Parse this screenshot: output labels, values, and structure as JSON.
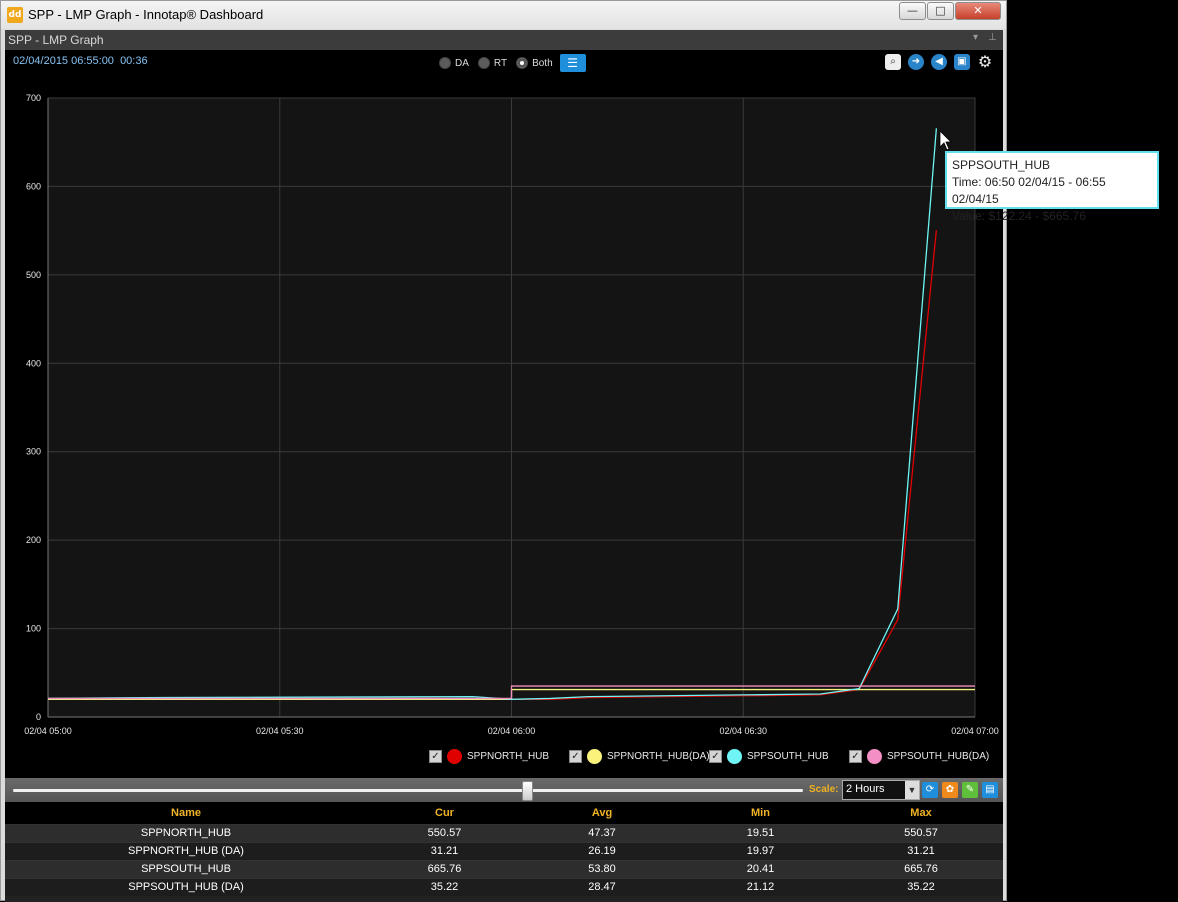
{
  "window": {
    "title": "SPP - LMP Graph - Innotap® Dashboard",
    "app_icon_text": "dd",
    "min": "—",
    "max": "□",
    "close": "✕"
  },
  "panel": {
    "title": "SPP - LMP Graph",
    "timestamp": "02/04/2015 06:55:00",
    "elapsed": "00:36",
    "modes": [
      "DA",
      "RT",
      "Both"
    ],
    "selected_mode": "Both"
  },
  "tooltip": {
    "series": "SPPSOUTH_HUB",
    "time": "Time: 06:50 02/04/15 - 06:55 02/04/15",
    "value": "Value: $122.24 - $665.76"
  },
  "chart_data": {
    "type": "line",
    "ylim": [
      0,
      700
    ],
    "yticks": [
      0,
      100,
      200,
      300,
      400,
      500,
      600,
      700
    ],
    "xlim": [
      "02/04 05:00",
      "02/04 07:00"
    ],
    "xtick_labels": [
      "02/04 05:00",
      "02/04 05:30",
      "02/04 06:00",
      "02/04 06:30",
      "02/04 07:00"
    ],
    "grid": true,
    "series": [
      {
        "name": "SPPNORTH_HUB",
        "color": "#e00000",
        "x": [
          "05:00",
          "05:50",
          "06:00",
          "06:05",
          "06:10",
          "06:20",
          "06:30",
          "06:40",
          "06:45",
          "06:50",
          "06:55"
        ],
        "values": [
          20,
          21,
          20,
          20,
          22,
          23,
          24,
          25,
          31,
          110,
          550.57
        ]
      },
      {
        "name": "SPPNORTH_HUB(DA)",
        "color": "#f2f07a",
        "x": [
          "05:00",
          "06:00",
          "06:00",
          "06:55",
          "07:00"
        ],
        "values": [
          20,
          20,
          31,
          31,
          31
        ]
      },
      {
        "name": "SPPSOUTH_HUB",
        "color": "#6ff5f5",
        "x": [
          "05:00",
          "05:15",
          "05:55",
          "06:00",
          "06:05",
          "06:10",
          "06:20",
          "06:30",
          "06:40",
          "06:45",
          "06:50",
          "06:55"
        ],
        "values": [
          21,
          22,
          23,
          20,
          21,
          23,
          24,
          25,
          26,
          32,
          122.24,
          665.76
        ]
      },
      {
        "name": "SPPSOUTH_HUB(DA)",
        "color": "#f08fc0",
        "x": [
          "05:00",
          "06:00",
          "06:00",
          "06:55",
          "07:00"
        ],
        "values": [
          21,
          21,
          35,
          35,
          35
        ]
      }
    ]
  },
  "legend": [
    {
      "label": "SPPNORTH_HUB",
      "color": "#e00000"
    },
    {
      "label": "SPPNORTH_HUB(DA)",
      "color": "#f9f37c"
    },
    {
      "label": "SPPSOUTH_HUB",
      "color": "#6ff5f5"
    },
    {
      "label": "SPPSOUTH_HUB(DA)",
      "color": "#f38fc4"
    }
  ],
  "scale": {
    "label": "Scale:",
    "value": "2 Hours"
  },
  "table": {
    "headers": [
      "Name",
      "Cur",
      "Avg",
      "Min",
      "Max"
    ],
    "rows": [
      [
        "SPPNORTH_HUB",
        "550.57",
        "47.37",
        "19.51",
        "550.57"
      ],
      [
        "SPPNORTH_HUB (DA)",
        "31.21",
        "26.19",
        "19.97",
        "31.21"
      ],
      [
        "SPPSOUTH_HUB",
        "665.76",
        "53.80",
        "20.41",
        "665.76"
      ],
      [
        "SPPSOUTH_HUB (DA)",
        "35.22",
        "28.47",
        "21.12",
        "35.22"
      ]
    ]
  }
}
